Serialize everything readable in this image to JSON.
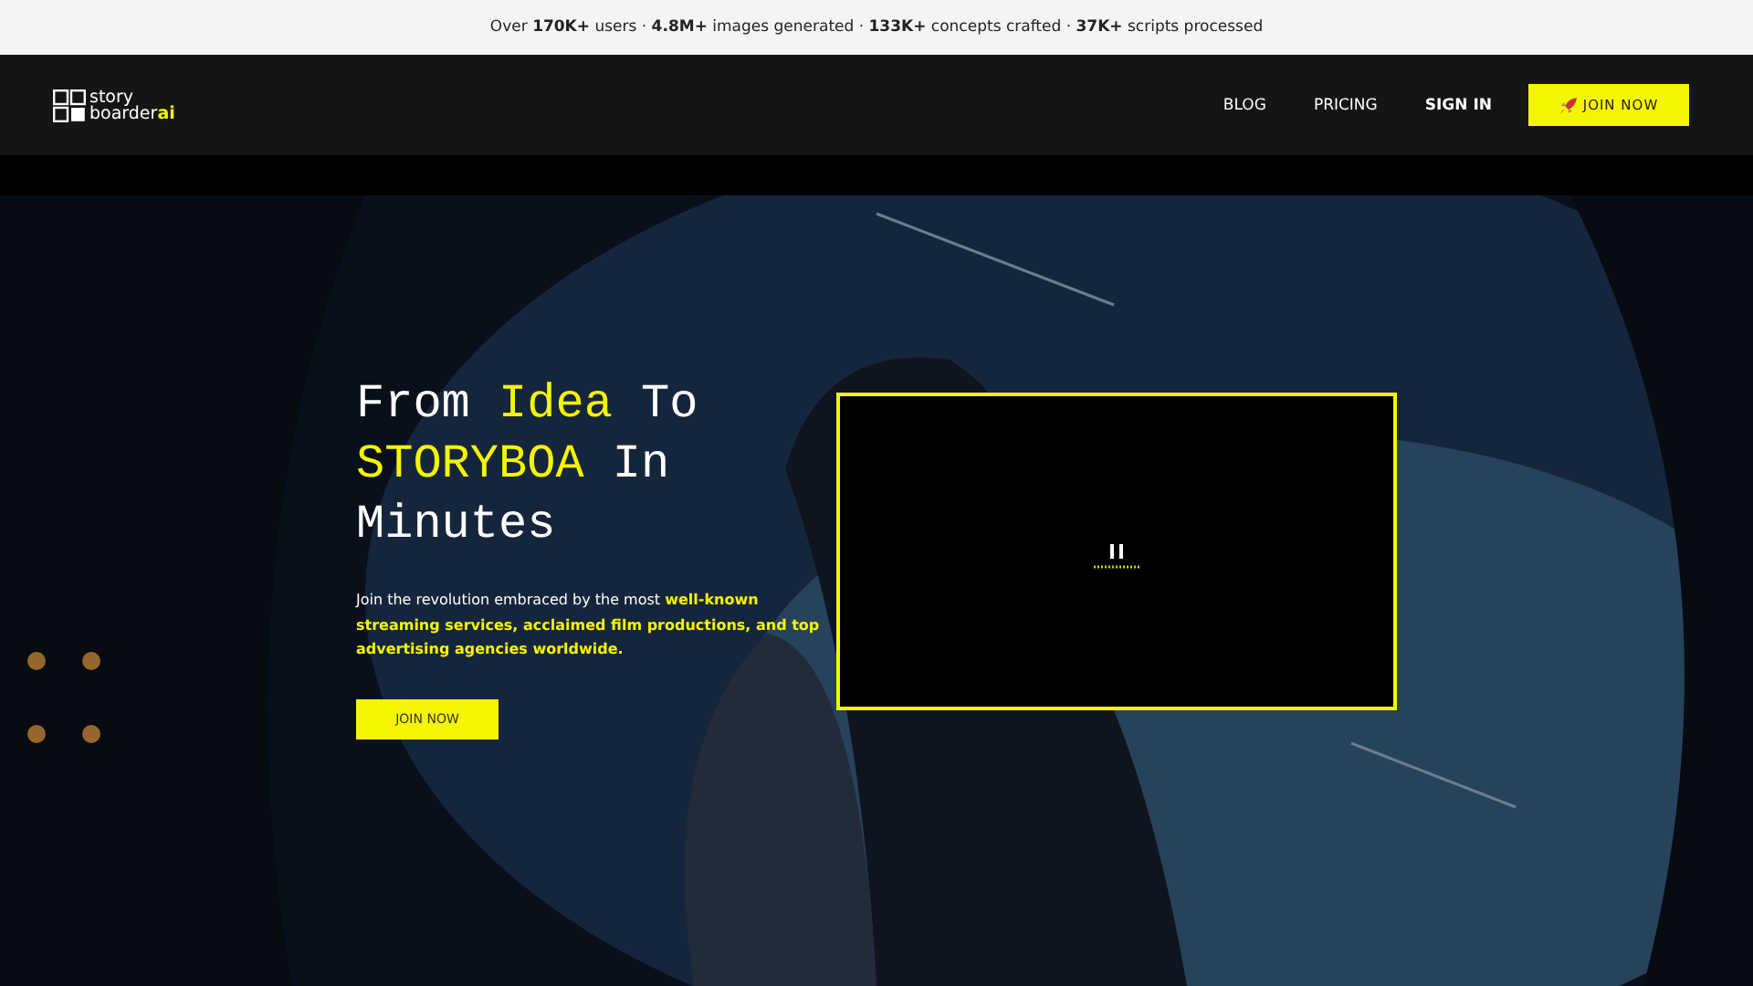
{
  "announcement": "Over **170K+** users · **4.8M+** images generated · **133K+** concepts crafted · **37K+** scripts processed",
  "nav": {
    "logo": {
      "line_1": "story",
      "line_2": "boarder",
      "accent": "ai"
    },
    "links": [
      {
        "label": "BLOG"
      },
      {
        "label": "PRICING"
      }
    ],
    "sign_in": "SIGN IN",
    "cta": "JOIN NOW"
  },
  "hero": {
    "heading": [
      {
        "text": "From ",
        "highlight": false
      },
      {
        "text": "Idea",
        "highlight": true
      },
      {
        "text": " To ",
        "highlight": false
      },
      {
        "text": "STORYBOA",
        "highlight": true
      },
      {
        "text": " In Minutes",
        "highlight": false
      }
    ],
    "description": "Join the revolution embraced by the most **well-known streaming services, acclaimed film productions, and top advertising agencies worldwide.**",
    "button": "JOIN NOW",
    "video": {
      "playing": true
    }
  }
}
